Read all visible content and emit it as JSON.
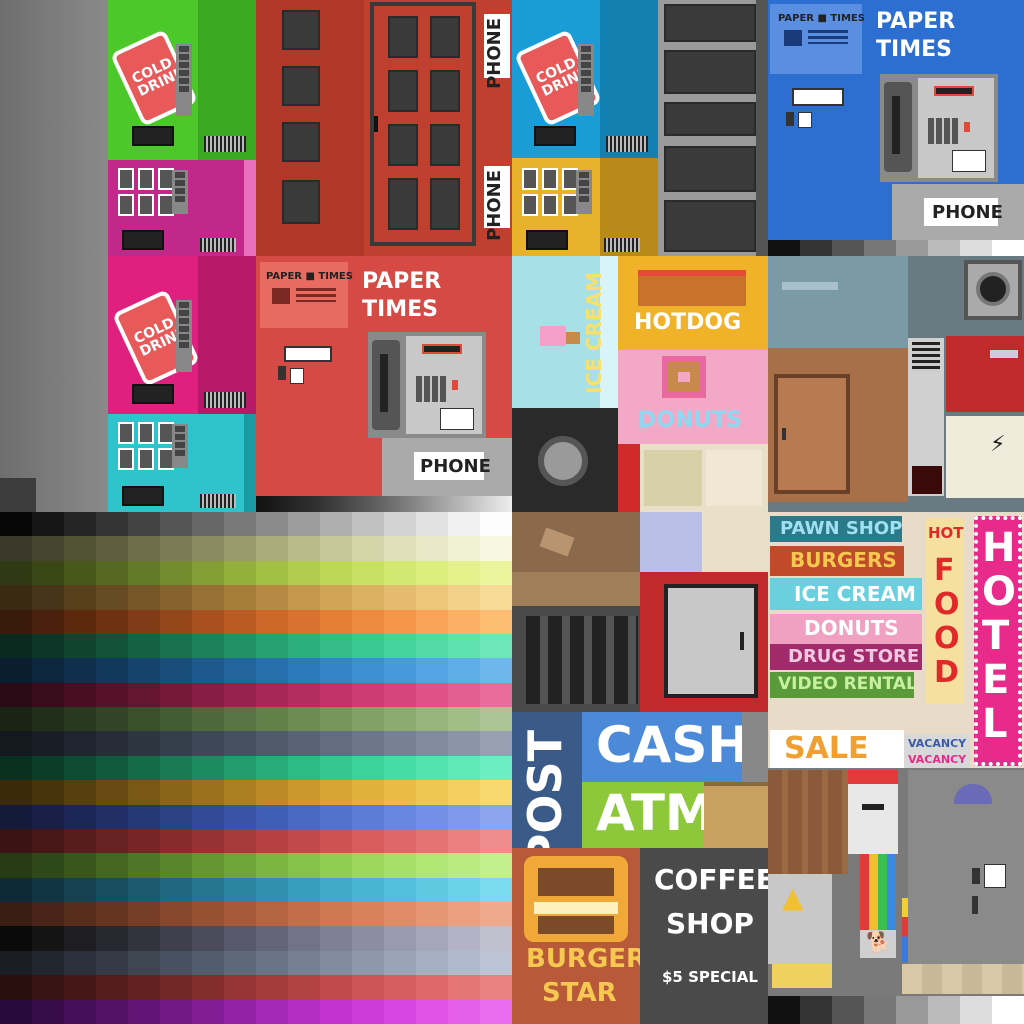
{
  "title": "",
  "labels": {
    "cold_drink": "COLD DRINK",
    "phone_1": "PHONE",
    "phone_2": "PHONE",
    "phone_3": "PHONE",
    "phone_4": "PHONE",
    "paper_header_1": "PAPER ■ TIMES",
    "paper_times_1": "PAPER TIMES",
    "paper_header_2": "PAPER ■ TIMES",
    "paper_times_2": "PAPER TIMES",
    "ice_cream_vertical": "ICE CREAM",
    "hotdog": "HOTDOG",
    "donuts": "DONUTS",
    "pawn_shop": "PAWN SHOP",
    "burgers": "BURGERS",
    "ice_cream": "ICE CREAM",
    "donuts_sign": "DONUTS",
    "drug_store": "DRUG STORE",
    "video_rental": "VIDEO RENTAL",
    "hot": "HOT",
    "food": "FOOD",
    "hotel": "HOTEL",
    "sale": "SALE",
    "vacancy_1": "VACANCY",
    "vacancy_2": "VACANCY",
    "post": "POST",
    "cash": "CASH",
    "atm": "ATM",
    "burger": "BURGER",
    "star": "STAR",
    "coffee": "COFFEE",
    "shop": "SHOP",
    "special": "$5 SPECIAL"
  },
  "colors": {
    "green": "#4cc82a",
    "magenta": "#c2288a",
    "pink": "#e0207f",
    "cyan": "#2fc4cc",
    "red": "#c0402f",
    "blue": "#1a9dd6",
    "yellow": "#e8b32a",
    "royal": "#2d6fd0",
    "coral": "#d64a45"
  },
  "icons": [
    "vending-buttons-icon",
    "coin-slot-icon",
    "grille-icon",
    "handset-icon",
    "keypad-icon",
    "door-icon",
    "speaker-icon",
    "warning-icon",
    "dog-icon",
    "lightning-icon"
  ],
  "palette_rows": [
    [
      "#060606",
      "#151515",
      "#242424",
      "#333333",
      "#434343",
      "#545454",
      "#666666",
      "#787878",
      "#8a8a8a",
      "#9c9c9c",
      "#aeaeae",
      "#c0c0c0",
      "#d2d2d2",
      "#e2e2e2",
      "#f0f0f0",
      "#fcfcfc"
    ],
    [
      "#3a3a2a",
      "#45452f",
      "#525237",
      "#5f5f40",
      "#6d6d4a",
      "#7b7b55",
      "#8b8b61",
      "#9a9a6e",
      "#aaaa7b",
      "#b9b98a",
      "#c7c799",
      "#d4d4a9",
      "#dfdfb8",
      "#e9e9c7",
      "#f1f1d5",
      "#f7f7e2"
    ],
    [
      "#2f3a14",
      "#3a4818",
      "#47581d",
      "#546822",
      "#637a28",
      "#738c2e",
      "#839e35",
      "#93b03c",
      "#a2c044",
      "#b0cd4d",
      "#bdd857",
      "#c9e163",
      "#d3e870",
      "#dcee7e",
      "#e4f28d",
      "#ebf69c"
    ],
    [
      "#3a2a14",
      "#483418",
      "#573f1c",
      "#664a21",
      "#765627",
      "#86632d",
      "#967034",
      "#a67d3b",
      "#b68a43",
      "#c4974c",
      "#d1a456",
      "#dcb061",
      "#e5bb6d",
      "#edc67a",
      "#f3d088",
      "#f8da97"
    ],
    [
      "#3a1a0a",
      "#4a210c",
      "#5c290f",
      "#6e3212",
      "#813b16",
      "#95461a",
      "#a8501f",
      "#bb5b24",
      "#cc6629",
      "#da722f",
      "#e57e37",
      "#ee8a40",
      "#f4974b",
      "#f8a357",
      "#fbb064",
      "#fdbd72"
    ],
    [
      "#0a2a20",
      "#0c3628",
      "#0f4431",
      "#12523b",
      "#156145",
      "#197150",
      "#1d815b",
      "#229166",
      "#27a171",
      "#2daf7c",
      "#34bc87",
      "#3cc892",
      "#46d29c",
      "#52daa6",
      "#5fe1b0",
      "#6de7b9"
    ],
    [
      "#0a1e30",
      "#0c263d",
      "#0f2f4c",
      "#12395b",
      "#15436b",
      "#194e7b",
      "#1d598c",
      "#22649c",
      "#276fac",
      "#2d7aba",
      "#3485c7",
      "#3c90d2",
      "#469adb",
      "#52a4e2",
      "#5faee8",
      "#6db7ed"
    ],
    [
      "#2a0a14",
      "#380c1a",
      "#470f21",
      "#561228",
      "#661530",
      "#761939",
      "#871d42",
      "#97224b",
      "#a72755",
      "#b52d5f",
      "#c23469",
      "#cd3c73",
      "#d6467d",
      "#de5287",
      "#e45f91",
      "#e96d9b"
    ],
    [
      "#1a2414",
      "#212e19",
      "#29391f",
      "#314425",
      "#3a502c",
      "#435c33",
      "#4d683a",
      "#577442",
      "#61804a",
      "#6b8c53",
      "#76975c",
      "#81a166",
      "#8cab71",
      "#97b47c",
      "#a2bd88",
      "#adc594"
    ],
    [
      "#14181f",
      "#191e26",
      "#1f252e",
      "#262d37",
      "#2d3541",
      "#353e4b",
      "#3d4755",
      "#465060",
      "#4f5a6b",
      "#586376",
      "#626d81",
      "#6c778b",
      "#768195",
      "#818b9f",
      "#8c95a8",
      "#979fb1"
    ],
    [
      "#0a3020",
      "#0c3d29",
      "#0f4b33",
      "#125a3d",
      "#156a48",
      "#197a54",
      "#1d8b60",
      "#229c6c",
      "#27ac78",
      "#2dbb84",
      "#34c890",
      "#3cd39b",
      "#46dca5",
      "#52e3af",
      "#5fe9b9",
      "#6deec2"
    ],
    [
      "#3a2a0a",
      "#48340c",
      "#583f0f",
      "#684b12",
      "#795715",
      "#8a6419",
      "#9b711d",
      "#ac7e22",
      "#bc8b27",
      "#ca982d",
      "#d6a534",
      "#e0b13c",
      "#e8bc46",
      "#eec652",
      "#f3d05f",
      "#f7d96d"
    ],
    [
      "#141a3a",
      "#182048",
      "#1c2757",
      "#212f66",
      "#263776",
      "#2c4086",
      "#324a96",
      "#3954a6",
      "#415eb5",
      "#4968c2",
      "#5272ce",
      "#5c7cd8",
      "#6786e0",
      "#7390e6",
      "#809aeb",
      "#8da4ef"
    ],
    [
      "#3a1414",
      "#481818",
      "#571c1c",
      "#662121",
      "#762626",
      "#862c2c",
      "#963232",
      "#a63939",
      "#b54141",
      "#c24949",
      "#ce5252",
      "#d85c5c",
      "#e06767",
      "#e67373",
      "#eb8080",
      "#ef8d8d"
    ],
    [
      "#263a14",
      "#2f4818",
      "#39571c",
      "#436621",
      "#4e7626",
      "#59862c",
      "#649632",
      "#6fa639",
      "#7ab541",
      "#85c249",
      "#90ce52",
      "#9bd85c",
      "#a6e067",
      "#b0e673",
      "#baeb80",
      "#c3ef8d"
    ],
    [
      "#0f2a36",
      "#123543",
      "#154151",
      "#184d60",
      "#1c5a6f",
      "#20677f",
      "#25758f",
      "#2a839f",
      "#3091ae",
      "#379ebc",
      "#3faac8",
      "#48b6d2",
      "#52c0db",
      "#5ecae2",
      "#6bd3e8",
      "#79dbed"
    ],
    [
      "#3a1e14",
      "#482518",
      "#572d1c",
      "#663521",
      "#763e26",
      "#86472c",
      "#965032",
      "#a65a39",
      "#b56441",
      "#c26e49",
      "#ce7852",
      "#d8825c",
      "#e08c67",
      "#e69673",
      "#eba080",
      "#efaa8d"
    ],
    [
      "#0a0a0a",
      "#141414",
      "#1e1e22",
      "#282830",
      "#33333e",
      "#3f3f4d",
      "#4b4b5c",
      "#58586b",
      "#65657a",
      "#727289",
      "#7f7f97",
      "#8c8ca4",
      "#9999b0",
      "#a6a6bb",
      "#b3b3c5",
      "#c0c0cf"
    ],
    [
      "#1a1e24",
      "#22272f",
      "#2b313a",
      "#343b46",
      "#3e4652",
      "#48515f",
      "#535c6c",
      "#5e6879",
      "#697487",
      "#758094",
      "#818ca1",
      "#8d98ad",
      "#99a4b8",
      "#a5afc2",
      "#b1bacc",
      "#bdc4d5"
    ],
    [
      "#2a0f0f",
      "#371313",
      "#451717",
      "#541c1c",
      "#632121",
      "#732727",
      "#832d2d",
      "#943434",
      "#a43b3b",
      "#b34343",
      "#c14b4b",
      "#cd5454",
      "#d75e5e",
      "#df6969",
      "#e57575",
      "#ea8282"
    ],
    [
      "#2a0a3a",
      "#370c48",
      "#450f57",
      "#541266",
      "#631576",
      "#731986",
      "#831d96",
      "#9422a6",
      "#a427b5",
      "#b32dc2",
      "#c134ce",
      "#cd3cd8",
      "#d746e0",
      "#df52e6",
      "#e55feb",
      "#ea6def"
    ]
  ]
}
